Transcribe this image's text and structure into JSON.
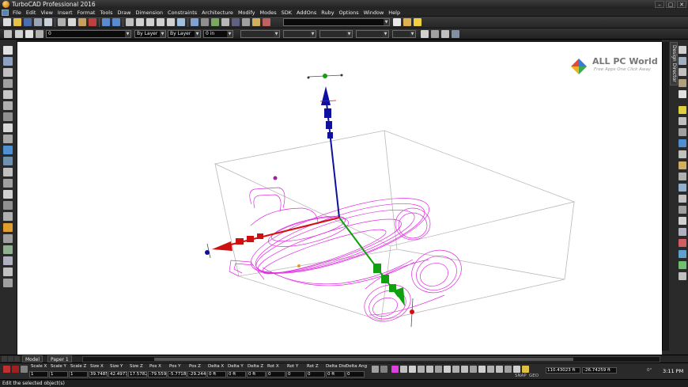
{
  "window": {
    "title": "TurboCAD Professional 2016",
    "controls": [
      "–",
      "▢",
      "✕"
    ]
  },
  "menu": [
    "File",
    "Edit",
    "View",
    "Insert",
    "Format",
    "Tools",
    "Draw",
    "Dimension",
    "Constraints",
    "Architecture",
    "Modify",
    "Modes",
    "SDK",
    "AddOns",
    "Ruby",
    "Options",
    "Window",
    "Help"
  ],
  "toolbar": {
    "layer_value": "0",
    "color_value": "By Layer",
    "linestyle_value": "By Layer",
    "width_value": "0 in"
  },
  "watermark": {
    "title": "ALL PC World",
    "subtitle": "Free Apps One Click Away"
  },
  "right_panel": {
    "tab_label": "Design Director"
  },
  "tabs": [
    "Model",
    "Paper 1"
  ],
  "inspector": {
    "fields": [
      {
        "label": "Scale X",
        "value": "1"
      },
      {
        "label": "Scale Y",
        "value": "1"
      },
      {
        "label": "Scale Z",
        "value": "1"
      },
      {
        "label": "Size X",
        "value": "39.74854"
      },
      {
        "label": "Size Y",
        "value": "42.49717"
      },
      {
        "label": "Size Z",
        "value": "17.57828"
      },
      {
        "label": "Pos X",
        "value": "-79.55971"
      },
      {
        "label": "Pos Y",
        "value": "-5.77188"
      },
      {
        "label": "Pos Z",
        "value": "-29.244 ft"
      },
      {
        "label": "Delta X",
        "value": "0 ft"
      },
      {
        "label": "Delta Y",
        "value": "0 ft"
      },
      {
        "label": "Delta Z",
        "value": "0 ft"
      },
      {
        "label": "Rot X",
        "value": "0"
      },
      {
        "label": "Rot Y",
        "value": "0"
      },
      {
        "label": "Rot Z",
        "value": "0"
      },
      {
        "label": "Delta Dist",
        "value": "0 ft"
      },
      {
        "label": "Delta Ang",
        "value": "0"
      }
    ],
    "snap": "SNAP",
    "geo": "GEO",
    "coord_x": "110.43023 ft",
    "coord_y": "-26.74259 ft",
    "zoom": "0°",
    "time": "3:11 PM"
  },
  "status": {
    "message": "Edit the selected object(s)"
  },
  "colors": {
    "wire": "#e02ce0",
    "axis_z": "#1010a0",
    "axis_x": "#d01010",
    "axis_y": "#10a010"
  }
}
